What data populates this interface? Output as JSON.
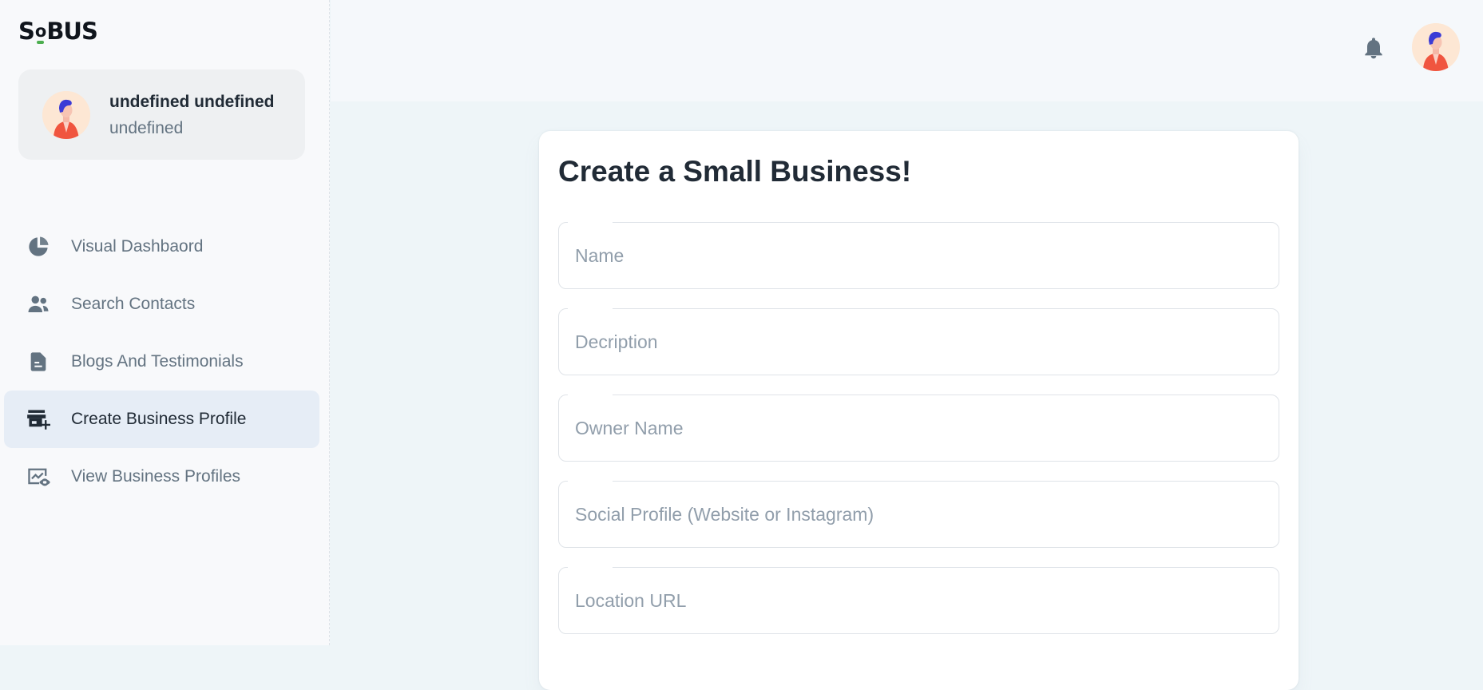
{
  "brand": {
    "logo_pre": "S",
    "logo_o": "o",
    "logo_post": "BUS"
  },
  "account": {
    "name": "undefined undefined",
    "role": "undefined"
  },
  "nav": {
    "items": [
      {
        "label": "Visual Dashbaord",
        "icon": "pie-chart-icon"
      },
      {
        "label": "Search Contacts",
        "icon": "people-icon"
      },
      {
        "label": "Blogs And Testimonials",
        "icon": "document-icon"
      },
      {
        "label": "Create Business Profile",
        "icon": "store-add-icon",
        "active": true
      },
      {
        "label": "View Business Profiles",
        "icon": "chart-view-icon"
      }
    ]
  },
  "header": {
    "notifications_icon": "bell-icon",
    "avatar_icon": "user-avatar-icon"
  },
  "form": {
    "title": "Create a Small Business!",
    "fields": {
      "name": {
        "placeholder": "Name",
        "value": ""
      },
      "description": {
        "placeholder": "Decription",
        "value": ""
      },
      "owner": {
        "placeholder": "Owner Name",
        "value": ""
      },
      "social": {
        "placeholder": "Social Profile (Website or Instagram)",
        "value": ""
      },
      "location": {
        "placeholder": "Location URL",
        "value": ""
      }
    }
  },
  "colors": {
    "accent_green": "#4cae4f",
    "active_nav_bg": "#e6edf6",
    "text_secondary": "#637381"
  }
}
